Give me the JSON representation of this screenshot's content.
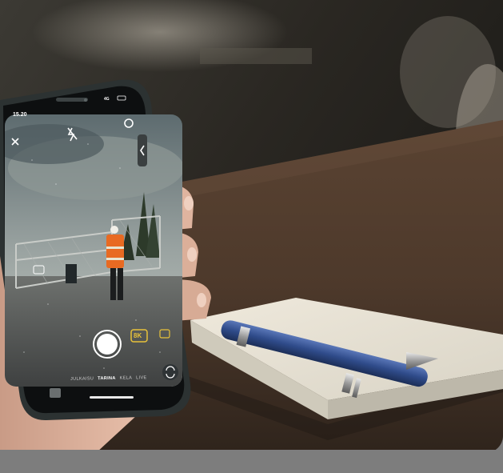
{
  "phone": {
    "status_time": "15.20",
    "status_signal": "4G",
    "video_quality_badge": "8K",
    "modes": [
      {
        "label": "JULKAISU",
        "active": false
      },
      {
        "label": "TARINA",
        "active": true
      },
      {
        "label": "KELA",
        "active": false
      },
      {
        "label": "LIVE",
        "active": false
      }
    ],
    "icons": [
      "close-icon",
      "flash-off-icon",
      "settings-icon",
      "chevron-left-icon",
      "gallery-icon",
      "camera-flip-icon"
    ]
  },
  "colors": {
    "table": "#4a3a30",
    "notebook": "#e8e3d6",
    "pen": "#2f4b8a",
    "phone_frame": "#2c3232",
    "vest": "#e86a22"
  }
}
